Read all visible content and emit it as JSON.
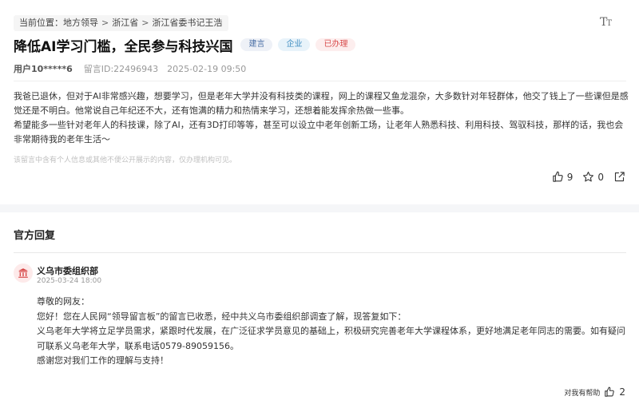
{
  "breadcrumb": {
    "prefix": "当前位置：",
    "items": [
      "地方领导",
      "浙江省",
      "浙江省委书记王浩"
    ],
    "separator": ">"
  },
  "font_toggle_icon": "font-size-icon",
  "message": {
    "title": "降低AI学习门槛，全民参与科技兴国",
    "tags": [
      "建言",
      "企业",
      "已办理"
    ],
    "user": "用户10*****6",
    "message_id": "留言ID:22496943",
    "time": "2025-02-19 09:50",
    "body": [
      "我爸已退休，但对于AI非常感兴趣，想要学习，但是老年大学并没有科技类的课程，网上的课程又鱼龙混杂，大多数针对年轻群体，他交了钱上了一些课但是感觉还是不明白。他常说自己年纪还不大，还有饱满的精力和热情来学习，还想着能发挥余热做一些事。",
      "希望能多一些针对老年人的科技课，除了AI，还有3D打印等等，甚至可以设立中老年创新工场，让老年人熟悉科技、利用科技、驾驭科技，那样的话，我也会非常期待我的老年生活～"
    ],
    "disclaimer": "该留言中含有个人信息或其他不便公开展示的内容，仅办理机构可见。",
    "likes": "9",
    "favorites": "0"
  },
  "reply_section": {
    "title": "官方回复",
    "org": "义乌市委组织部",
    "time": "2025-03-24 18:00",
    "paragraphs": [
      "尊敬的网友：",
      "您好！您在人民网“领导留言板”的留言已收悉，经中共义乌市委组织部调查了解，现答复如下：",
      "义乌老年大学将立足学员需求，紧跟时代发展，在广泛征求学员意见的基础上，积极研究完善老年大学课程体系，更好地满足老年同志的需要。如有疑问可联系义乌老年大学，联系电话0579-89059156。",
      "感谢您对我们工作的理解与支持！"
    ],
    "helpful_label": "对我有帮助",
    "helpful_count": "2"
  },
  "colors": {
    "tag_suggest": "#4a6fa5",
    "tag_company": "#3e8cc0",
    "tag_done": "#d84b4b",
    "avatar_bg": "#fdeaea",
    "avatar_icon": "#d84b4b"
  }
}
